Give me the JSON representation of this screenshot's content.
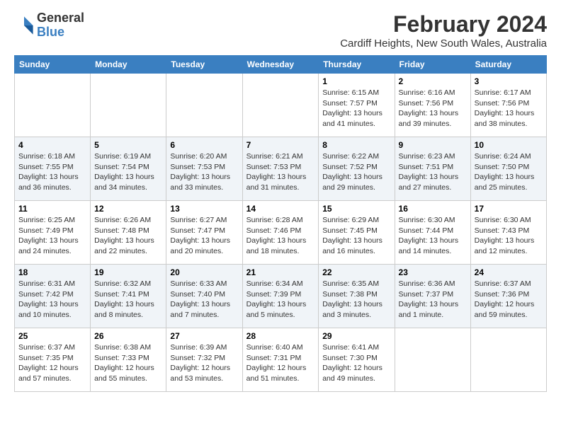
{
  "logo": {
    "general": "General",
    "blue": "Blue"
  },
  "header": {
    "title": "February 2024",
    "subtitle": "Cardiff Heights, New South Wales, Australia"
  },
  "days_of_week": [
    "Sunday",
    "Monday",
    "Tuesday",
    "Wednesday",
    "Thursday",
    "Friday",
    "Saturday"
  ],
  "weeks": [
    [
      {
        "day": "",
        "info": ""
      },
      {
        "day": "",
        "info": ""
      },
      {
        "day": "",
        "info": ""
      },
      {
        "day": "",
        "info": ""
      },
      {
        "day": "1",
        "info": "Sunrise: 6:15 AM\nSunset: 7:57 PM\nDaylight: 13 hours and 41 minutes."
      },
      {
        "day": "2",
        "info": "Sunrise: 6:16 AM\nSunset: 7:56 PM\nDaylight: 13 hours and 39 minutes."
      },
      {
        "day": "3",
        "info": "Sunrise: 6:17 AM\nSunset: 7:56 PM\nDaylight: 13 hours and 38 minutes."
      }
    ],
    [
      {
        "day": "4",
        "info": "Sunrise: 6:18 AM\nSunset: 7:55 PM\nDaylight: 13 hours and 36 minutes."
      },
      {
        "day": "5",
        "info": "Sunrise: 6:19 AM\nSunset: 7:54 PM\nDaylight: 13 hours and 34 minutes."
      },
      {
        "day": "6",
        "info": "Sunrise: 6:20 AM\nSunset: 7:53 PM\nDaylight: 13 hours and 33 minutes."
      },
      {
        "day": "7",
        "info": "Sunrise: 6:21 AM\nSunset: 7:53 PM\nDaylight: 13 hours and 31 minutes."
      },
      {
        "day": "8",
        "info": "Sunrise: 6:22 AM\nSunset: 7:52 PM\nDaylight: 13 hours and 29 minutes."
      },
      {
        "day": "9",
        "info": "Sunrise: 6:23 AM\nSunset: 7:51 PM\nDaylight: 13 hours and 27 minutes."
      },
      {
        "day": "10",
        "info": "Sunrise: 6:24 AM\nSunset: 7:50 PM\nDaylight: 13 hours and 25 minutes."
      }
    ],
    [
      {
        "day": "11",
        "info": "Sunrise: 6:25 AM\nSunset: 7:49 PM\nDaylight: 13 hours and 24 minutes."
      },
      {
        "day": "12",
        "info": "Sunrise: 6:26 AM\nSunset: 7:48 PM\nDaylight: 13 hours and 22 minutes."
      },
      {
        "day": "13",
        "info": "Sunrise: 6:27 AM\nSunset: 7:47 PM\nDaylight: 13 hours and 20 minutes."
      },
      {
        "day": "14",
        "info": "Sunrise: 6:28 AM\nSunset: 7:46 PM\nDaylight: 13 hours and 18 minutes."
      },
      {
        "day": "15",
        "info": "Sunrise: 6:29 AM\nSunset: 7:45 PM\nDaylight: 13 hours and 16 minutes."
      },
      {
        "day": "16",
        "info": "Sunrise: 6:30 AM\nSunset: 7:44 PM\nDaylight: 13 hours and 14 minutes."
      },
      {
        "day": "17",
        "info": "Sunrise: 6:30 AM\nSunset: 7:43 PM\nDaylight: 13 hours and 12 minutes."
      }
    ],
    [
      {
        "day": "18",
        "info": "Sunrise: 6:31 AM\nSunset: 7:42 PM\nDaylight: 13 hours and 10 minutes."
      },
      {
        "day": "19",
        "info": "Sunrise: 6:32 AM\nSunset: 7:41 PM\nDaylight: 13 hours and 8 minutes."
      },
      {
        "day": "20",
        "info": "Sunrise: 6:33 AM\nSunset: 7:40 PM\nDaylight: 13 hours and 7 minutes."
      },
      {
        "day": "21",
        "info": "Sunrise: 6:34 AM\nSunset: 7:39 PM\nDaylight: 13 hours and 5 minutes."
      },
      {
        "day": "22",
        "info": "Sunrise: 6:35 AM\nSunset: 7:38 PM\nDaylight: 13 hours and 3 minutes."
      },
      {
        "day": "23",
        "info": "Sunrise: 6:36 AM\nSunset: 7:37 PM\nDaylight: 13 hours and 1 minute."
      },
      {
        "day": "24",
        "info": "Sunrise: 6:37 AM\nSunset: 7:36 PM\nDaylight: 12 hours and 59 minutes."
      }
    ],
    [
      {
        "day": "25",
        "info": "Sunrise: 6:37 AM\nSunset: 7:35 PM\nDaylight: 12 hours and 57 minutes."
      },
      {
        "day": "26",
        "info": "Sunrise: 6:38 AM\nSunset: 7:33 PM\nDaylight: 12 hours and 55 minutes."
      },
      {
        "day": "27",
        "info": "Sunrise: 6:39 AM\nSunset: 7:32 PM\nDaylight: 12 hours and 53 minutes."
      },
      {
        "day": "28",
        "info": "Sunrise: 6:40 AM\nSunset: 7:31 PM\nDaylight: 12 hours and 51 minutes."
      },
      {
        "day": "29",
        "info": "Sunrise: 6:41 AM\nSunset: 7:30 PM\nDaylight: 12 hours and 49 minutes."
      },
      {
        "day": "",
        "info": ""
      },
      {
        "day": "",
        "info": ""
      }
    ]
  ]
}
